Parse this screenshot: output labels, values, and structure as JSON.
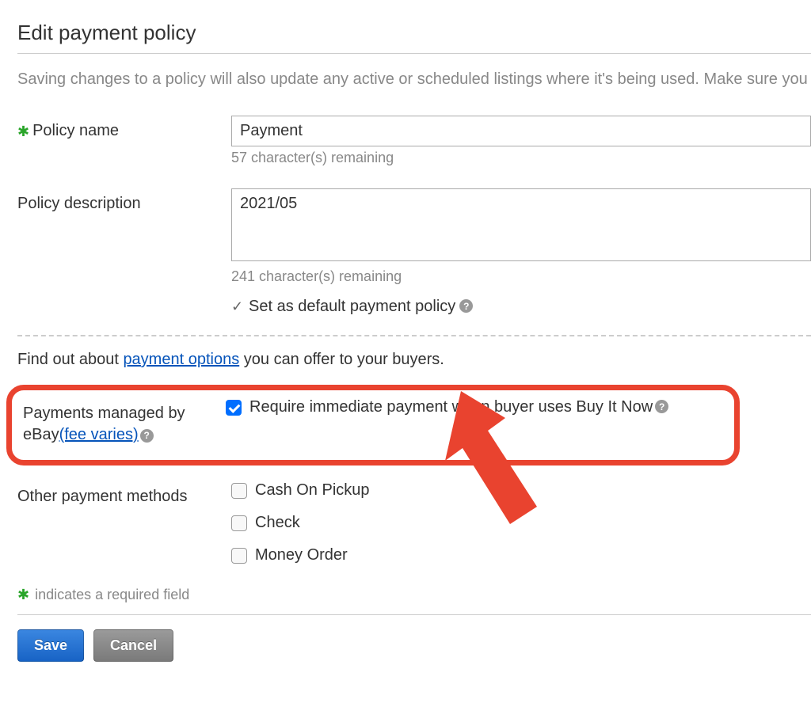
{
  "page": {
    "title": "Edit payment policy",
    "warning": "Saving changes to a policy will also update any active or scheduled listings where it's being used. Make sure you know which listings will be affected before saving changes."
  },
  "form": {
    "policy_name": {
      "label": "Policy name",
      "value": "Payment",
      "hint": "57 character(s) remaining"
    },
    "policy_description": {
      "label": "Policy description",
      "value": "2021/05",
      "hint": "241 character(s) remaining"
    },
    "default_policy_label": "Set as default payment policy"
  },
  "info": {
    "prefix": "Find out about ",
    "link": "payment options",
    "suffix": " you can offer to your buyers."
  },
  "managed_payments": {
    "label_prefix": "Payments managed by eBay",
    "fee_link": "(fee varies)",
    "checkbox_label": "Require immediate payment when buyer uses Buy It Now"
  },
  "other_methods": {
    "label": "Other payment methods",
    "options": [
      "Cash On Pickup",
      "Check",
      "Money Order"
    ]
  },
  "footnote": "indicates a required field",
  "buttons": {
    "save": "Save",
    "cancel": "Cancel"
  }
}
